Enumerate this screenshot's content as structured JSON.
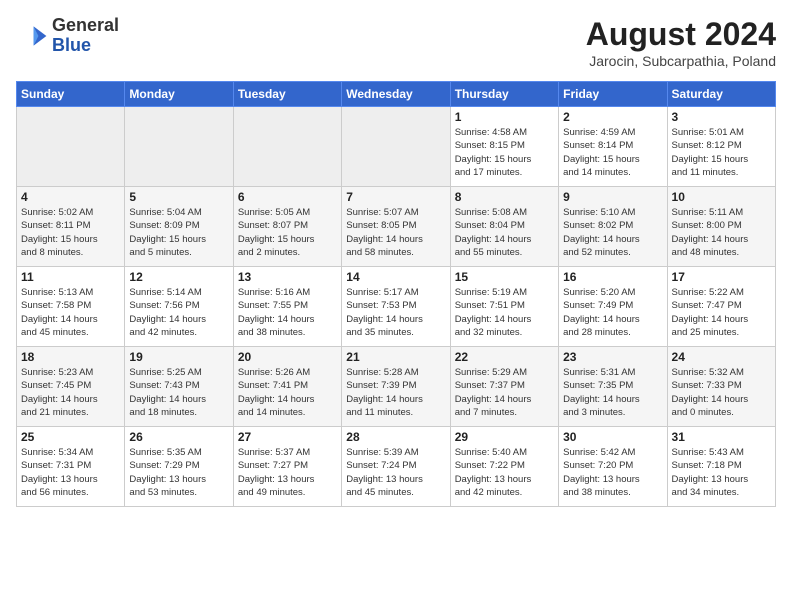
{
  "header": {
    "logo_line1": "General",
    "logo_line2": "Blue",
    "month": "August 2024",
    "location": "Jarocin, Subcarpathia, Poland"
  },
  "weekdays": [
    "Sunday",
    "Monday",
    "Tuesday",
    "Wednesday",
    "Thursday",
    "Friday",
    "Saturday"
  ],
  "weeks": [
    [
      {
        "day": null
      },
      {
        "day": null
      },
      {
        "day": null
      },
      {
        "day": null
      },
      {
        "day": 1,
        "info": "Sunrise: 4:58 AM\nSunset: 8:15 PM\nDaylight: 15 hours\nand 17 minutes."
      },
      {
        "day": 2,
        "info": "Sunrise: 4:59 AM\nSunset: 8:14 PM\nDaylight: 15 hours\nand 14 minutes."
      },
      {
        "day": 3,
        "info": "Sunrise: 5:01 AM\nSunset: 8:12 PM\nDaylight: 15 hours\nand 11 minutes."
      }
    ],
    [
      {
        "day": 4,
        "info": "Sunrise: 5:02 AM\nSunset: 8:11 PM\nDaylight: 15 hours\nand 8 minutes."
      },
      {
        "day": 5,
        "info": "Sunrise: 5:04 AM\nSunset: 8:09 PM\nDaylight: 15 hours\nand 5 minutes."
      },
      {
        "day": 6,
        "info": "Sunrise: 5:05 AM\nSunset: 8:07 PM\nDaylight: 15 hours\nand 2 minutes."
      },
      {
        "day": 7,
        "info": "Sunrise: 5:07 AM\nSunset: 8:05 PM\nDaylight: 14 hours\nand 58 minutes."
      },
      {
        "day": 8,
        "info": "Sunrise: 5:08 AM\nSunset: 8:04 PM\nDaylight: 14 hours\nand 55 minutes."
      },
      {
        "day": 9,
        "info": "Sunrise: 5:10 AM\nSunset: 8:02 PM\nDaylight: 14 hours\nand 52 minutes."
      },
      {
        "day": 10,
        "info": "Sunrise: 5:11 AM\nSunset: 8:00 PM\nDaylight: 14 hours\nand 48 minutes."
      }
    ],
    [
      {
        "day": 11,
        "info": "Sunrise: 5:13 AM\nSunset: 7:58 PM\nDaylight: 14 hours\nand 45 minutes."
      },
      {
        "day": 12,
        "info": "Sunrise: 5:14 AM\nSunset: 7:56 PM\nDaylight: 14 hours\nand 42 minutes."
      },
      {
        "day": 13,
        "info": "Sunrise: 5:16 AM\nSunset: 7:55 PM\nDaylight: 14 hours\nand 38 minutes."
      },
      {
        "day": 14,
        "info": "Sunrise: 5:17 AM\nSunset: 7:53 PM\nDaylight: 14 hours\nand 35 minutes."
      },
      {
        "day": 15,
        "info": "Sunrise: 5:19 AM\nSunset: 7:51 PM\nDaylight: 14 hours\nand 32 minutes."
      },
      {
        "day": 16,
        "info": "Sunrise: 5:20 AM\nSunset: 7:49 PM\nDaylight: 14 hours\nand 28 minutes."
      },
      {
        "day": 17,
        "info": "Sunrise: 5:22 AM\nSunset: 7:47 PM\nDaylight: 14 hours\nand 25 minutes."
      }
    ],
    [
      {
        "day": 18,
        "info": "Sunrise: 5:23 AM\nSunset: 7:45 PM\nDaylight: 14 hours\nand 21 minutes."
      },
      {
        "day": 19,
        "info": "Sunrise: 5:25 AM\nSunset: 7:43 PM\nDaylight: 14 hours\nand 18 minutes."
      },
      {
        "day": 20,
        "info": "Sunrise: 5:26 AM\nSunset: 7:41 PM\nDaylight: 14 hours\nand 14 minutes."
      },
      {
        "day": 21,
        "info": "Sunrise: 5:28 AM\nSunset: 7:39 PM\nDaylight: 14 hours\nand 11 minutes."
      },
      {
        "day": 22,
        "info": "Sunrise: 5:29 AM\nSunset: 7:37 PM\nDaylight: 14 hours\nand 7 minutes."
      },
      {
        "day": 23,
        "info": "Sunrise: 5:31 AM\nSunset: 7:35 PM\nDaylight: 14 hours\nand 3 minutes."
      },
      {
        "day": 24,
        "info": "Sunrise: 5:32 AM\nSunset: 7:33 PM\nDaylight: 14 hours\nand 0 minutes."
      }
    ],
    [
      {
        "day": 25,
        "info": "Sunrise: 5:34 AM\nSunset: 7:31 PM\nDaylight: 13 hours\nand 56 minutes."
      },
      {
        "day": 26,
        "info": "Sunrise: 5:35 AM\nSunset: 7:29 PM\nDaylight: 13 hours\nand 53 minutes."
      },
      {
        "day": 27,
        "info": "Sunrise: 5:37 AM\nSunset: 7:27 PM\nDaylight: 13 hours\nand 49 minutes."
      },
      {
        "day": 28,
        "info": "Sunrise: 5:39 AM\nSunset: 7:24 PM\nDaylight: 13 hours\nand 45 minutes."
      },
      {
        "day": 29,
        "info": "Sunrise: 5:40 AM\nSunset: 7:22 PM\nDaylight: 13 hours\nand 42 minutes."
      },
      {
        "day": 30,
        "info": "Sunrise: 5:42 AM\nSunset: 7:20 PM\nDaylight: 13 hours\nand 38 minutes."
      },
      {
        "day": 31,
        "info": "Sunrise: 5:43 AM\nSunset: 7:18 PM\nDaylight: 13 hours\nand 34 minutes."
      }
    ]
  ]
}
